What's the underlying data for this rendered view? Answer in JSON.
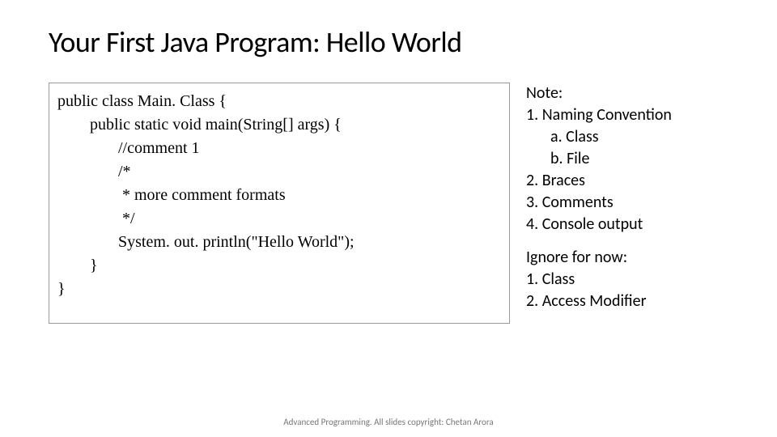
{
  "title": "Your First Java Program: Hello World",
  "code": {
    "l1": "public class Main. Class {",
    "l2": "        public static void main(String[] args) {",
    "l3": "",
    "l4": "               //comment 1",
    "l5": "               /*",
    "l6": "                * more comment formats",
    "l7": "                */",
    "l8": "               System. out. println(\"Hello World\");",
    "l9": "        }",
    "l10": "}"
  },
  "notes1": {
    "heading": "Note:",
    "i1": "1. Naming Convention",
    "i1a": "a.   Class",
    "i1b": "b.   File",
    "i2": "2. Braces",
    "i3": "3. Comments",
    "i4": "4. Console output"
  },
  "notes2": {
    "heading": "Ignore for now:",
    "i1": "1. Class",
    "i2": "2. Access Modifier"
  },
  "footer": "Advanced Programming. All slides copyright: Chetan Arora"
}
